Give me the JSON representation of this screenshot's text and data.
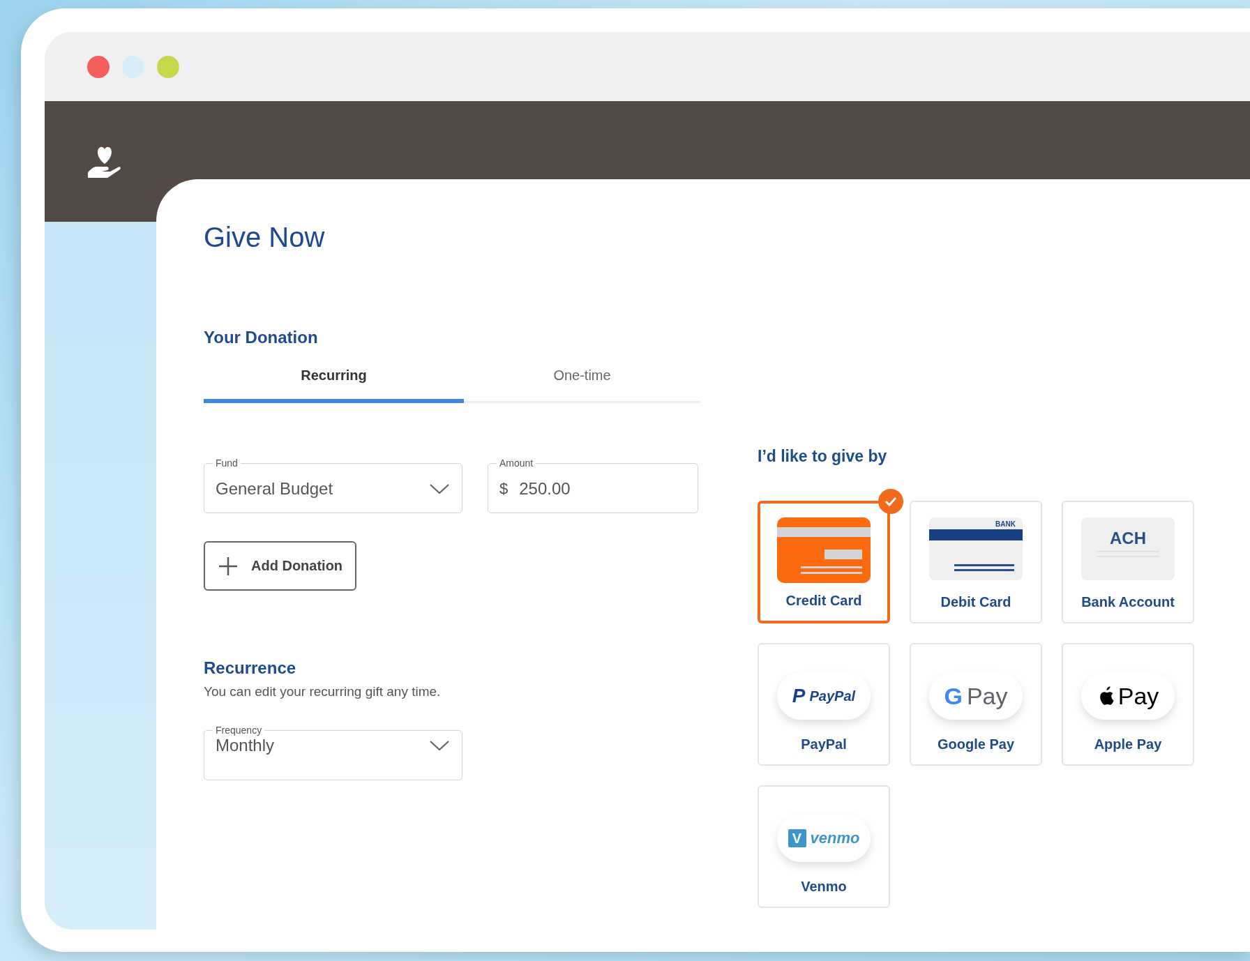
{
  "window": {
    "controls": [
      {
        "color": "#f25f5c"
      },
      {
        "color": "#d6eef9"
      },
      {
        "color": "#c6d94b"
      }
    ]
  },
  "page": {
    "title": "Give Now"
  },
  "donation": {
    "heading": "Your Donation",
    "tabs": [
      {
        "label": "Recurring",
        "selected": true
      },
      {
        "label": "One-time",
        "selected": false
      }
    ],
    "fund": {
      "label": "Fund",
      "value": "General Budget"
    },
    "amount": {
      "label": "Amount",
      "prefix": "$",
      "value": "250.00"
    },
    "add_button": "Add Donation"
  },
  "recurrence": {
    "heading": "Recurrence",
    "note": "You can edit your recurring gift any time.",
    "frequency": {
      "label": "Frequency",
      "value": "Monthly"
    }
  },
  "payment": {
    "heading": "I’d like to give by",
    "methods": [
      {
        "kind": "credit",
        "label": "Credit Card",
        "selected": true
      },
      {
        "kind": "debit",
        "label": "Debit Card",
        "logo_text": "BANK",
        "selected": false
      },
      {
        "kind": "bank",
        "label": "Bank Account",
        "logo_text": "ACH",
        "selected": false
      },
      {
        "kind": "paypal",
        "label": "PayPal",
        "logo_mark": "P",
        "logo_text": "PayPal",
        "selected": false
      },
      {
        "kind": "google",
        "label": "Google Pay",
        "logo_mark": "G",
        "logo_text": "Pay",
        "selected": false
      },
      {
        "kind": "apple",
        "label": "Apple Pay",
        "logo_text": "Pay",
        "selected": false
      },
      {
        "kind": "venmo",
        "label": "Venmo",
        "logo_mark": "V",
        "logo_text": "venmo",
        "selected": false
      }
    ]
  }
}
